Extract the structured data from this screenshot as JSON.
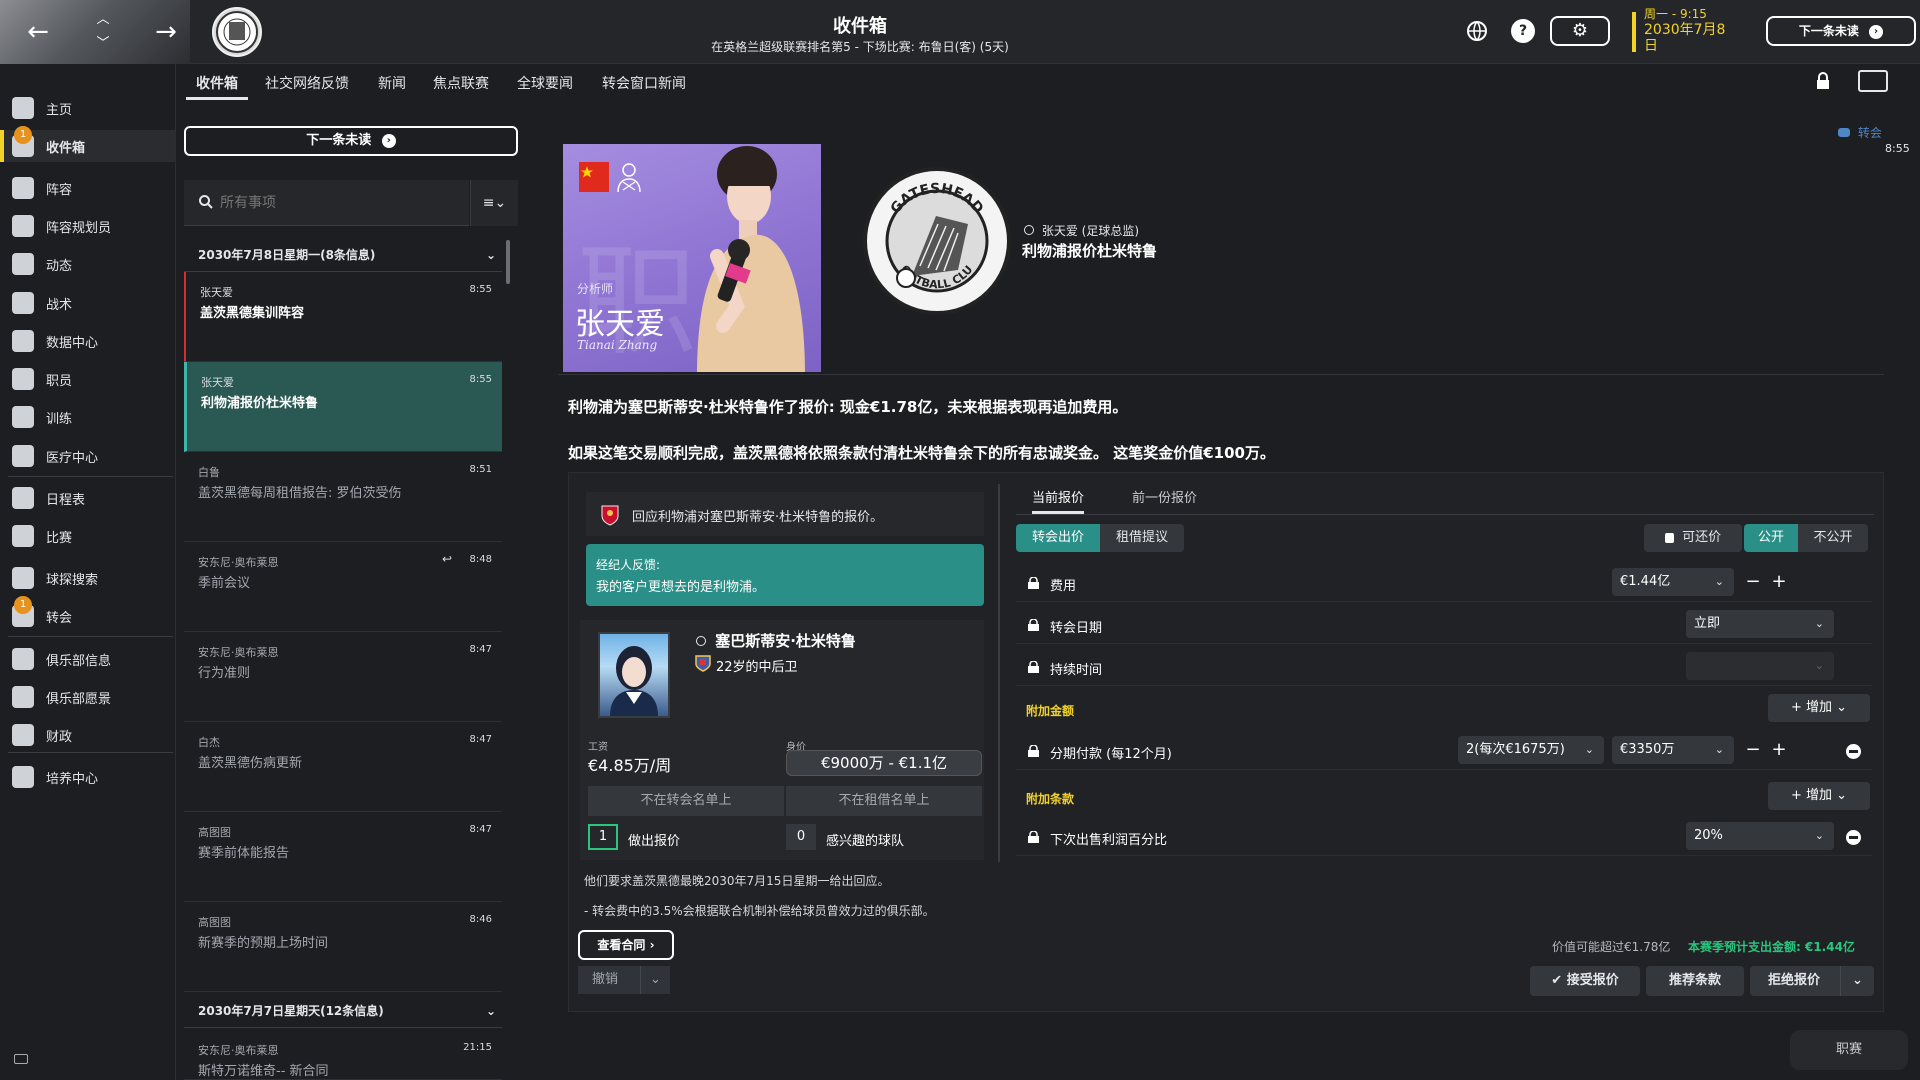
{
  "header": {
    "title": "收件箱",
    "subtitle": "在英格兰超级联赛排名第5 - 下场比赛: 布鲁日(客) (5天)",
    "date_line1": "周一 - 9:15",
    "date_line2": "2030年7月8",
    "date_line3": "日",
    "next_unread": "下一条未读",
    "help_symbol": "?"
  },
  "sidebar": {
    "items": [
      {
        "label": "主页",
        "icon": "home-icon"
      },
      {
        "label": "收件箱",
        "icon": "inbox-icon",
        "badge": "1"
      },
      {
        "label": "阵容",
        "icon": "shirt-icon"
      },
      {
        "label": "阵容规划员",
        "icon": "clipboard-icon"
      },
      {
        "label": "动态",
        "icon": "dynamics-icon"
      },
      {
        "label": "战术",
        "icon": "tactics-icon"
      },
      {
        "label": "数据中心",
        "icon": "data-icon"
      },
      {
        "label": "职员",
        "icon": "staff-icon"
      },
      {
        "label": "训练",
        "icon": "training-icon"
      },
      {
        "label": "医疗中心",
        "icon": "medical-icon"
      },
      {
        "label": "日程表",
        "icon": "calendar-icon"
      },
      {
        "label": "比赛",
        "icon": "trophy-icon"
      },
      {
        "label": "球探搜索",
        "icon": "search-icon"
      },
      {
        "label": "转会",
        "icon": "transfer-icon",
        "badge": "1"
      },
      {
        "label": "俱乐部信息",
        "icon": "shield-icon"
      },
      {
        "label": "俱乐部愿景",
        "icon": "briefcase-icon"
      },
      {
        "label": "财政",
        "icon": "money-icon"
      },
      {
        "label": "培养中心",
        "icon": "growth-icon"
      }
    ]
  },
  "tabs": [
    "收件箱",
    "社交网络反馈",
    "新闻",
    "焦点联赛",
    "全球要闻",
    "转会窗口新闻"
  ],
  "inbox": {
    "next_unread": "下一条未读",
    "search_placeholder": "所有事项",
    "date_group_1": "2030年7月8日星期一(8条信息)",
    "date_group_2": "2030年7月7日星期天(12条信息)",
    "messages": [
      {
        "sender": "张天爱",
        "time": "8:55",
        "subject": "盖茨黑德集训阵容"
      },
      {
        "sender": "张天爱",
        "time": "8:55",
        "subject": "利物浦报价杜米特鲁"
      },
      {
        "sender": "白鲁",
        "time": "8:51",
        "subject": "盖茨黑德每周租借报告: 罗伯茨受伤"
      },
      {
        "sender": "安东尼·奥布莱恩",
        "time": "8:48",
        "subject": "季前会议"
      },
      {
        "sender": "安东尼·奥布莱恩",
        "time": "8:47",
        "subject": "行为准则"
      },
      {
        "sender": "白杰",
        "time": "8:47",
        "subject": "盖茨黑德伤病更新"
      },
      {
        "sender": "高图图",
        "time": "8:47",
        "subject": "赛季前体能报告"
      },
      {
        "sender": "高图图",
        "time": "8:46",
        "subject": "新赛季的预期上场时间"
      },
      {
        "sender": "安东尼·奥布莱恩",
        "time": "21:15",
        "subject": "斯特万诺维奇-- 新合同"
      }
    ]
  },
  "message": {
    "analyst_role": "分析师",
    "analyst_name": "张天爱",
    "analyst_name_en": "Tianai Zhang",
    "analyst_bg_char": "职",
    "crest_text_top": "GATESHEAD",
    "crest_text_bottom": "FOOTBALL CLUB",
    "from": "张天爱 (足球总监)",
    "subject": "利物浦报价杜米特鲁",
    "channel": "转会",
    "time": "8:55",
    "body_1": "利物浦为塞巴斯蒂安·杜米特鲁作了报价: 现金€1.78亿，未来根据表现再追加费用。",
    "body_2": "如果这笔交易顺利完成，盖茨黑德将依照条款付清杜米特鲁余下的所有忠诚奖金。 这笔奖金价值€100万。"
  },
  "negotiation": {
    "respond_text": "回应利物浦对塞巴斯蒂安·杜米特鲁的报价。",
    "agent_label": "经纪人反馈:",
    "agent_text": "我的客户更想去的是利物浦。",
    "player_name": "塞巴斯蒂安·杜米特鲁",
    "player_desc": "22岁的中后卫",
    "wage_label": "工资",
    "wage_value": "€4.85万/周",
    "value_label": "身价",
    "value_range": "€9000万 - €1.1亿",
    "not_transfer_listed": "不在转会名单上",
    "not_loan_listed": "不在租借名单上",
    "offers_count": "1",
    "offers_label": "做出报价",
    "interested_count": "0",
    "interested_label": "感兴趣的球队",
    "deadline": "他们要求盖茨黑德最晚2030年7月15日星期一给出回应。",
    "solidarity": "- 转会费中的3.5%会根据联合机制补偿给球员曾效力过的俱乐部。",
    "view_contract": "查看合同",
    "cancel": "撤销"
  },
  "offer": {
    "tab_current": "当前报价",
    "tab_previous": "前一份报价",
    "type_transfer": "转会出价",
    "type_loan": "租借提议",
    "negotiable": "可还价",
    "public": "公开",
    "private": "不公开",
    "fee_label": "费用",
    "fee_value": "€1.44亿",
    "date_label": "转会日期",
    "date_value": "立即",
    "duration_label": "持续时间",
    "add_fee_section": "附加金额",
    "add_label": "增加",
    "installments_label": "分期付款 (每12个月)",
    "installments_count": "2(每次€1675万)",
    "installments_value": "€3350万",
    "add_clause_section": "附加条款",
    "sell_on_label": "下次出售利润百分比",
    "sell_on_value": "20%",
    "value_note": "价值可能超过€1.78亿",
    "budget_note": "本赛季预计支出金额: €1.44亿",
    "accept": "接受报价",
    "suggest": "推荐条款",
    "reject": "拒绝报价"
  },
  "watermark": "职赛",
  "colors": {
    "accent_teal": "#2a8f87",
    "accent_yellow": "#f2d229",
    "positive_green": "#2bc57d",
    "badge_orange": "#e8921e",
    "analyst_purple": "#8e73d2"
  }
}
